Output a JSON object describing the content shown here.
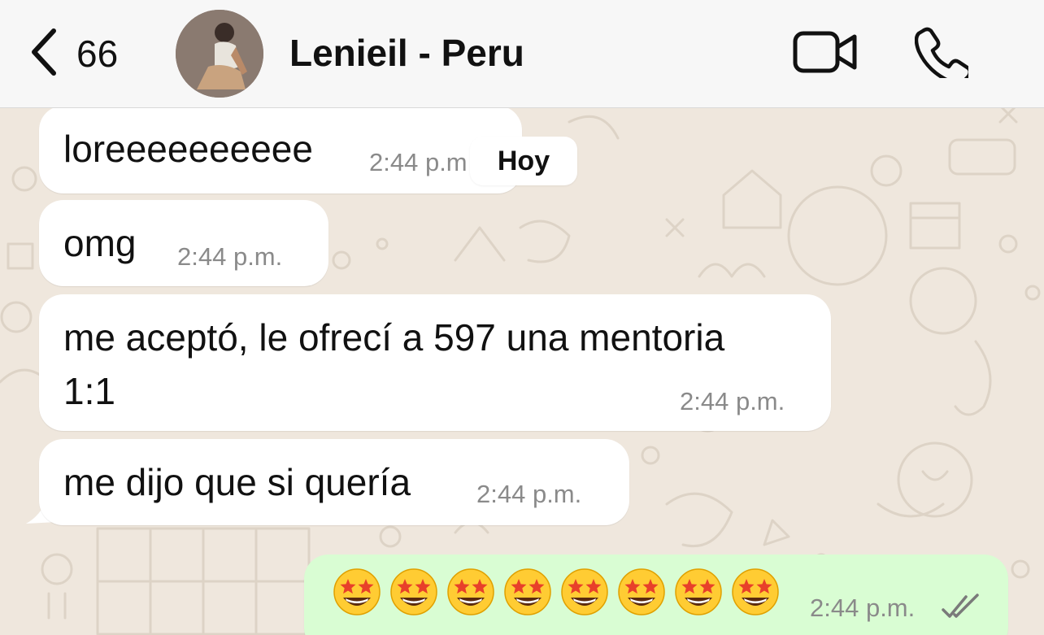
{
  "header": {
    "back_count": "66",
    "contact_name": "Lenieil - Peru"
  },
  "date_chip": "Hoy",
  "messages": [
    {
      "direction": "in",
      "text": "loreeeeeeeeee",
      "time": "2:44 p.m"
    },
    {
      "direction": "in",
      "text": "omg",
      "time": "2:44 p.m."
    },
    {
      "direction": "in",
      "text_line1": "me aceptó, le ofrecí a 597 una mentoria",
      "text_line2": "1:1",
      "time": "2:44 p.m."
    },
    {
      "direction": "in",
      "text": "me dijo que si quería",
      "time": "2:44 p.m."
    },
    {
      "direction": "out",
      "emoji_count": 8,
      "emoji": "star-struck",
      "time": "2:44 p.m.",
      "status": "read"
    }
  ],
  "colors": {
    "chat_background": "#efe7dd",
    "incoming_bubble": "#ffffff",
    "outgoing_bubble": "#d9fdd3",
    "timestamp": "#8a8a8a"
  }
}
